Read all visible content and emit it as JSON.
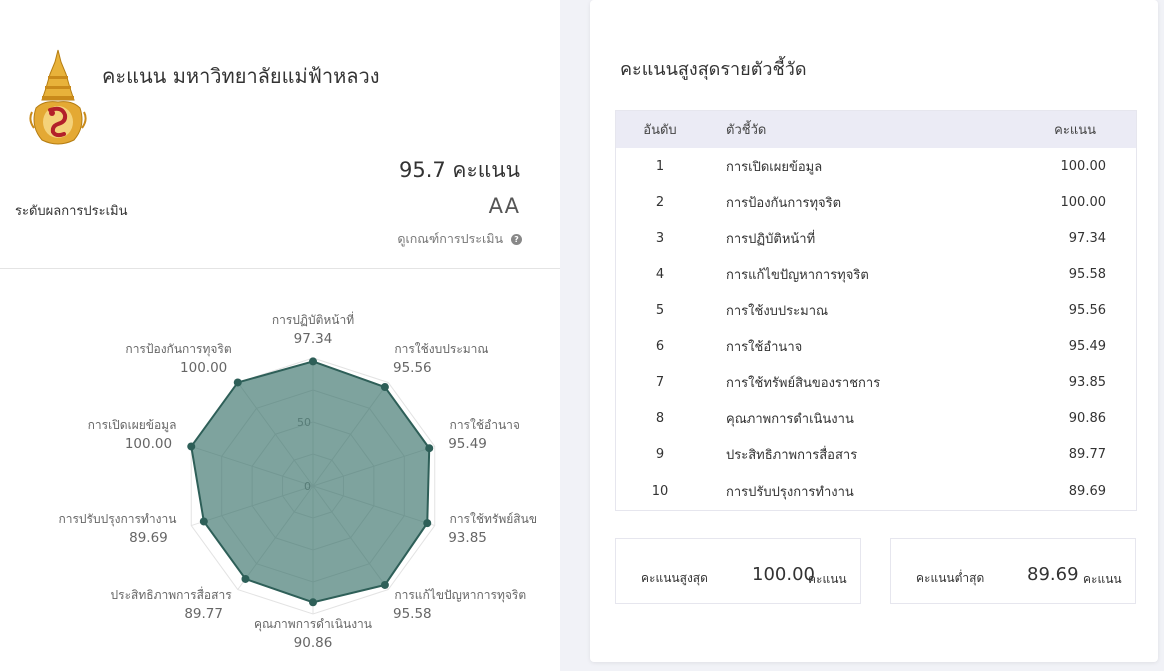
{
  "header": {
    "title": "คะแนน มหาวิทยาลัยแม่ฟ้าหลวง",
    "score_text": "95.7 คะแนน",
    "level_label": "ระดับผลการประเมิน",
    "level_value": "AA",
    "criteria_link": "ดูเกณฑ์การประเมิน",
    "help_icon": "question-circle-icon",
    "logo": "university-emblem-logo"
  },
  "chart_data": {
    "type": "radar",
    "axes": [
      "การปฏิบัติหน้าที่",
      "การใช้งบประมาณ",
      "การใช้อำนาจ",
      "การใช้ทรัพย์สินของราชการ",
      "การแก้ไขปัญหาการทุจริต",
      "คุณภาพการดำเนินงาน",
      "ประสิทธิภาพการสื่อสาร",
      "การปรับปรุงการทำงาน",
      "การเปิดเผยข้อมูล",
      "การป้องกันการทุจริต"
    ],
    "axis_label_display": [
      "การปฏิบัติหน้าที่",
      "การใช้งบประมาณ",
      "การใช้อำนาจ",
      "การใช้ทรัพย์สินข",
      "การแก้ไขปัญหาการทุจริต",
      "คุณภาพการดำเนินงาน",
      "ประสิทธิภาพการสื่อสาร",
      "การปรับปรุงการทำงาน",
      "การเปิดเผยข้อมูล",
      "การป้องกันการทุจริต"
    ],
    "values": [
      97.34,
      95.56,
      95.49,
      93.85,
      95.58,
      90.86,
      89.77,
      89.69,
      100.0,
      100.0
    ],
    "value_labels": [
      "97.34",
      "95.56",
      "95.49",
      "93.85",
      "95.58",
      "90.86",
      "89.77",
      "89.69",
      "100.00",
      "100.00"
    ],
    "scale_ticks": [
      "0",
      "50"
    ],
    "rlim": [
      0,
      100
    ],
    "fill_color": "#2e6b62",
    "line_color": "#2e5f58"
  },
  "table": {
    "title": "คะแนนสูงสุดรายตัวชี้วัด",
    "columns": [
      "อันดับ",
      "ตัวชี้วัด",
      "คะแนน"
    ],
    "rows": [
      {
        "rank": "1",
        "name": "การเปิดเผยข้อมูล",
        "score": "100.00"
      },
      {
        "rank": "2",
        "name": "การป้องกันการทุจริต",
        "score": "100.00"
      },
      {
        "rank": "3",
        "name": "การปฏิบัติหน้าที่",
        "score": "97.34"
      },
      {
        "rank": "4",
        "name": "การแก้ไขปัญหาการทุจริต",
        "score": "95.58"
      },
      {
        "rank": "5",
        "name": "การใช้งบประมาณ",
        "score": "95.56"
      },
      {
        "rank": "6",
        "name": "การใช้อำนาจ",
        "score": "95.49"
      },
      {
        "rank": "7",
        "name": "การใช้ทรัพย์สินของราชการ",
        "score": "93.85"
      },
      {
        "rank": "8",
        "name": "คุณภาพการดำเนินงาน",
        "score": "90.86"
      },
      {
        "rank": "9",
        "name": "ประสิทธิภาพการสื่อสาร",
        "score": "89.77"
      },
      {
        "rank": "10",
        "name": "การปรับปรุงการทำงาน",
        "score": "89.69"
      }
    ]
  },
  "summary": {
    "max_label": "คะแนนสูงสุด",
    "max_value": "100.00",
    "max_unit": "คะแนน",
    "min_label": "คะแนนต่ำสุด",
    "min_value": "89.69",
    "min_unit": "คะแนน"
  }
}
